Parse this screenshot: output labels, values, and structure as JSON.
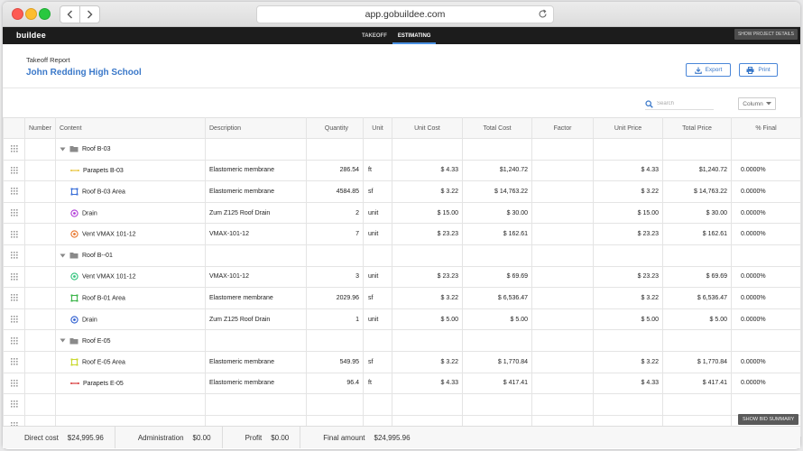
{
  "browser": {
    "url": "app.gobuildee.com"
  },
  "app": {
    "brand": "buildee",
    "tabs": [
      {
        "label": "TAKEOFF",
        "active": false
      },
      {
        "label": "ESTIMATING",
        "active": true
      }
    ],
    "project_details_button": "SHOW PROJECT DETAILS"
  },
  "report": {
    "label": "Takeoff Report",
    "project": "John Redding High School",
    "export_label": "Export",
    "print_label": "Print"
  },
  "toolbar": {
    "search_placeholder": "Search",
    "column_label": "Column"
  },
  "table": {
    "columns": [
      "Number",
      "Content",
      "Description",
      "Quantity",
      "Unit",
      "Unit Cost",
      "Total Cost",
      "Factor",
      "Unit Price",
      "Total Price",
      "% Final"
    ],
    "rows": [
      {
        "type": "group",
        "content": "Roof B-03"
      },
      {
        "type": "item",
        "icon": "line-icon",
        "icon_color": "#e8c53a",
        "content": "Parapets B-03",
        "description": "Elastomeric membrane",
        "quantity": "286.54",
        "unit": "ft",
        "unit_cost": "$ 4.33",
        "total_cost": "$1,240.72",
        "factor": "",
        "unit_price": "$ 4.33",
        "total_price": "$1,240.72",
        "final": "0.0000%"
      },
      {
        "type": "item",
        "icon": "area-icon",
        "icon_color": "#3a6fd8",
        "content": "Roof B-03 Area",
        "description": "Elastomeric membrane",
        "quantity": "4584.85",
        "unit": "sf",
        "unit_cost": "$ 3.22",
        "total_cost": "$ 14,763.22",
        "factor": "",
        "unit_price": "$ 3.22",
        "total_price": "$ 14,763.22",
        "final": "0.0000%"
      },
      {
        "type": "item",
        "icon": "count-icon",
        "icon_color": "#b03ad8",
        "content": "Drain",
        "description": "Zum Z125 Roof Drain",
        "quantity": "2",
        "unit": "unit",
        "unit_cost": "$ 15.00",
        "total_cost": "$ 30.00",
        "factor": "",
        "unit_price": "$ 15.00",
        "total_price": "$ 30.00",
        "final": "0.0000%"
      },
      {
        "type": "item",
        "icon": "count-icon",
        "icon_color": "#e8742a",
        "content": "Vent VMAX 101-12",
        "description": "VMAX-101-12",
        "quantity": "7",
        "unit": "unit",
        "unit_cost": "$ 23.23",
        "total_cost": "$ 162.61",
        "factor": "",
        "unit_price": "$ 23.23",
        "total_price": "$ 162.61",
        "final": "0.0000%"
      },
      {
        "type": "group",
        "content": "Roof B--01"
      },
      {
        "type": "item",
        "icon": "count-icon",
        "icon_color": "#2ec27a",
        "content": "Vent VMAX 101-12",
        "description": "VMAX-101-12",
        "quantity": "3",
        "unit": "unit",
        "unit_cost": "$ 23.23",
        "total_cost": "$ 69.69",
        "factor": "",
        "unit_price": "$ 23.23",
        "total_price": "$ 69.69",
        "final": "0.0000%"
      },
      {
        "type": "item",
        "icon": "area-icon",
        "icon_color": "#3bb54a",
        "content": "Roof B-01 Area",
        "description": "Elastomere membrane",
        "quantity": "2029.96",
        "unit": "sf",
        "unit_cost": "$ 3.22",
        "total_cost": "$ 6,536.47",
        "factor": "",
        "unit_price": "$ 3.22",
        "total_price": "$ 6,536.47",
        "final": "0.0000%"
      },
      {
        "type": "item",
        "icon": "count-icon",
        "icon_color": "#2f5fd0",
        "content": "Drain",
        "description": "Zum Z125 Roof Drain",
        "quantity": "1",
        "unit": "unit",
        "unit_cost": "$ 5.00",
        "total_cost": "$ 5.00",
        "factor": "",
        "unit_price": "$ 5.00",
        "total_price": "$ 5.00",
        "final": "0.0000%"
      },
      {
        "type": "group",
        "content": "Roof E-05"
      },
      {
        "type": "item",
        "icon": "area-icon",
        "icon_color": "#c9d82e",
        "content": "Roof E-05 Area",
        "description": "Elastomeric membrane",
        "quantity": "549.95",
        "unit": "sf",
        "unit_cost": "$ 3.22",
        "total_cost": "$ 1,770.84",
        "factor": "",
        "unit_price": "$ 3.22",
        "total_price": "$ 1,770.84",
        "final": "0.0000%"
      },
      {
        "type": "item",
        "icon": "line-icon",
        "icon_color": "#d83a3a",
        "content": "Parapets E-05",
        "description": "Elastomeric membrane",
        "quantity": "96.4",
        "unit": "ft",
        "unit_cost": "$ 4.33",
        "total_cost": "$ 417.41",
        "factor": "",
        "unit_price": "$ 4.33",
        "total_price": "$ 417.41",
        "final": "0.0000%"
      },
      {
        "type": "empty"
      },
      {
        "type": "empty"
      }
    ]
  },
  "summary_button": "SHOW BID SUMMARY",
  "footer": {
    "items": [
      {
        "label": "Direct cost",
        "value": "$24,995.96"
      },
      {
        "label": "Administration",
        "value": "$0.00"
      },
      {
        "label": "Profit",
        "value": "$0.00"
      },
      {
        "label": "Final amount",
        "value": "$24,995.96"
      }
    ]
  }
}
